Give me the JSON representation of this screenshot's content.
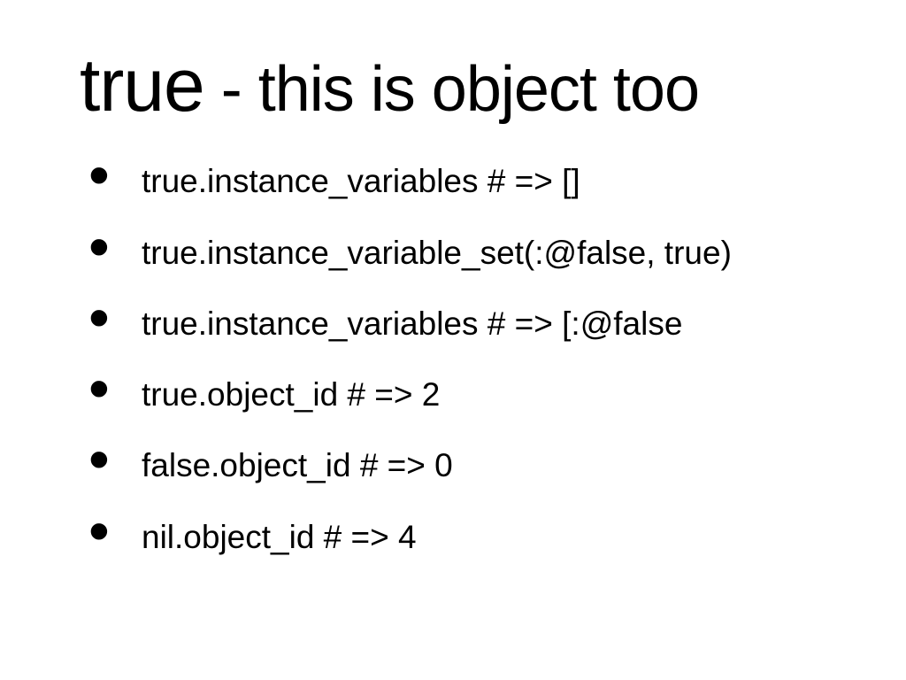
{
  "title": {
    "code": "true",
    "rest": " - this is object too"
  },
  "bullets": [
    "true.instance_variables # => []",
    "true.instance_variable_set(:@false, true)",
    "true.instance_variables # => [:@false",
    "true.object_id # => 2",
    "false.object_id # => 0",
    " nil.object_id   # => 4"
  ]
}
